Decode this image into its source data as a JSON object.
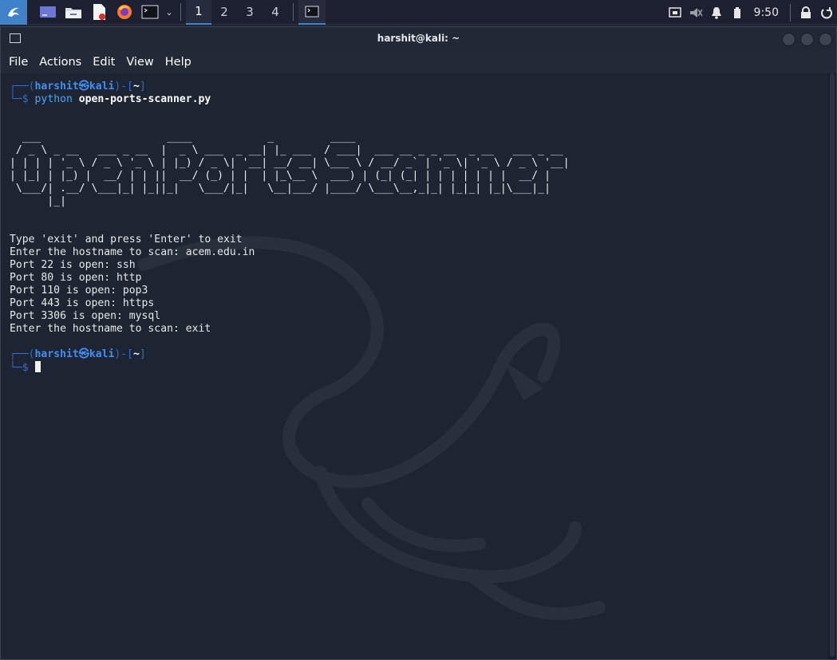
{
  "taskbar": {
    "workspaces": [
      "1",
      "2",
      "3",
      "4"
    ],
    "active_workspace": "1",
    "clock": "9:50",
    "accent_color": "#3f82c9"
  },
  "window": {
    "title": "harshit@kali: ~",
    "menu": [
      "File",
      "Actions",
      "Edit",
      "View",
      "Help"
    ]
  },
  "terminal": {
    "prompt1": {
      "top_left": "┌──(",
      "user": "harshit",
      "at": "㉿",
      "host": "kali",
      "mid": ")-[",
      "dir": "~",
      "end": "]",
      "bottom": "└─$ ",
      "command": "python",
      "argument": "open-ports-scanner.py"
    },
    "banner": [
      "  ___                    ____            _         ____",
      " / _ \\ _ __   ___ _ __  |  _ \\ ___  _ __| |_ ___  / ___|  ___ __ _ _ __  _ __   ___ _ __",
      "| | | | '_ \\ / _ \\ '_ \\ | |_) / _ \\| '__| __/ __| \\___ \\ / __/ _` | '_ \\| '_ \\ / _ \\ '__|",
      "| |_| | |_) |  __/ | | ||  __/ (_) | |  | |_\\__ \\  ___) | (_| (_| | | | | | | |  __/ |",
      " \\___/| .__/ \\___|_| |_||_|   \\___/|_|   \\__|___/ |____/ \\___\\__,_|_| |_|_| |_|\\___|_|",
      "      |_|"
    ],
    "output": [
      "Type 'exit' and press 'Enter' to exit",
      "Enter the hostname to scan: acem.edu.in",
      "Port 22 is open: ssh",
      "Port 80 is open: http",
      "Port 110 is open: pop3",
      "Port 443 is open: https",
      "Port 3306 is open: mysql",
      "Enter the hostname to scan: exit"
    ],
    "prompt2": {
      "top_left": "┌──(",
      "user": "harshit",
      "at": "㉿",
      "host": "kali",
      "mid": ")-[",
      "dir": "~",
      "end": "]",
      "bottom": "└─$ "
    }
  }
}
